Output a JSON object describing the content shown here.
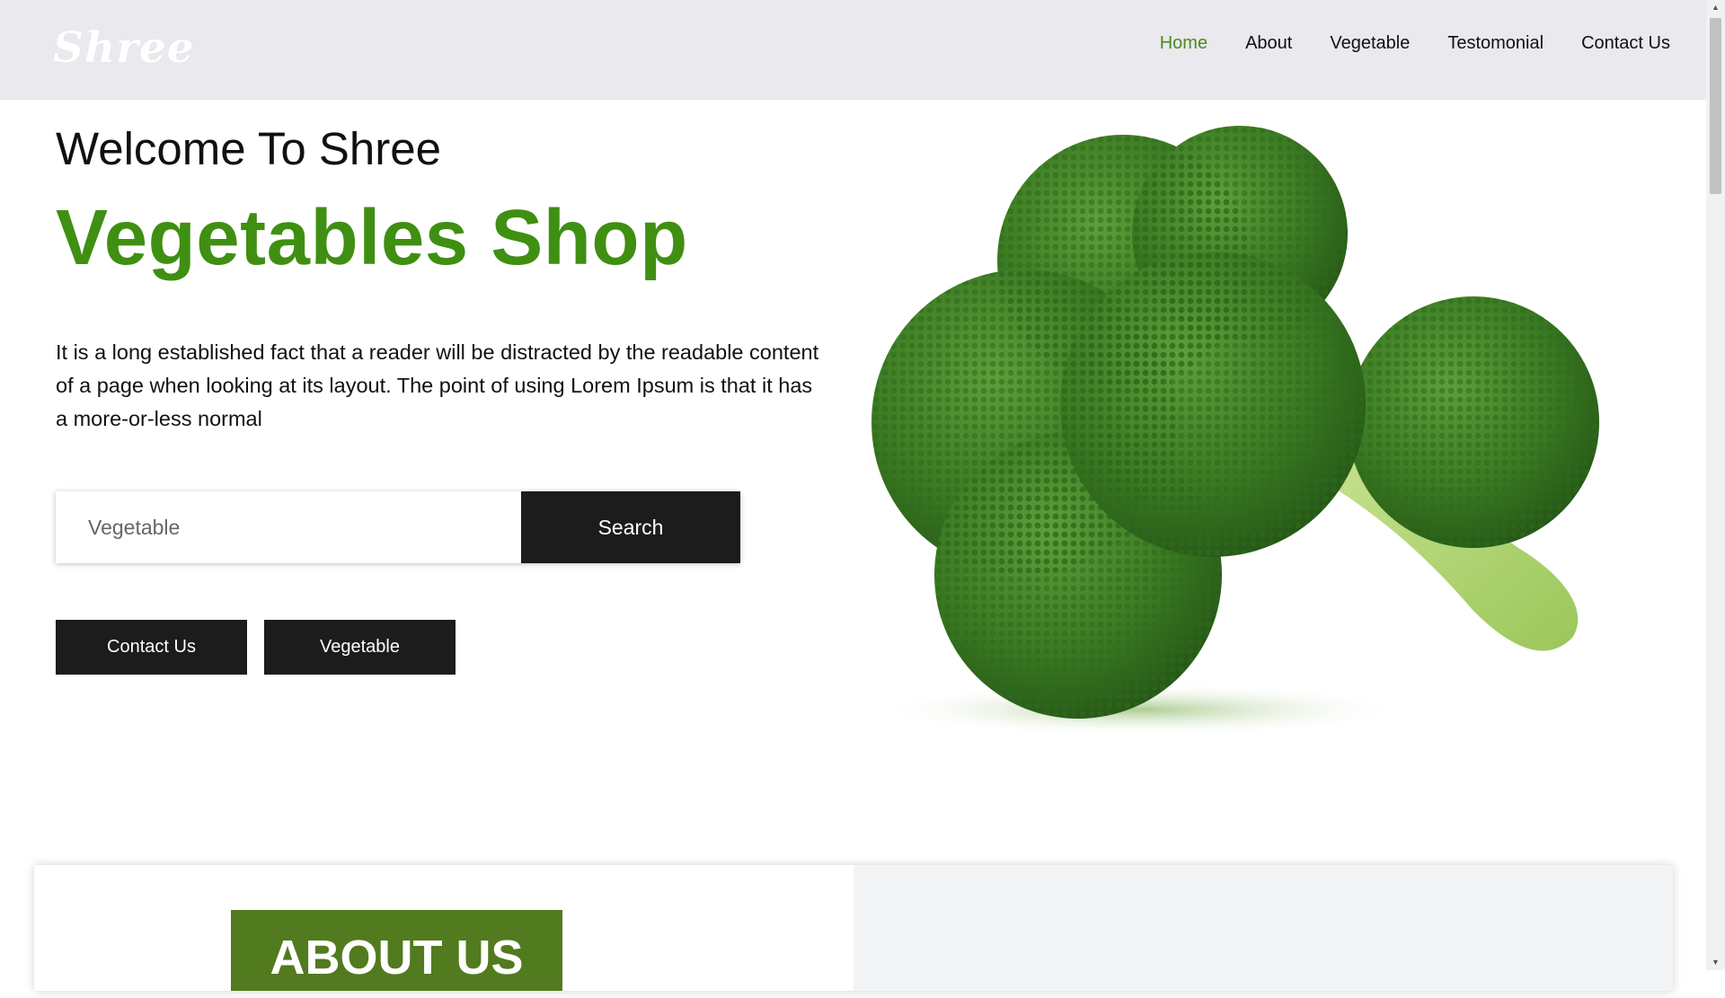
{
  "header": {
    "logo": "Shree",
    "nav": [
      {
        "label": "Home",
        "active": true
      },
      {
        "label": "About",
        "active": false
      },
      {
        "label": "Vegetable",
        "active": false
      },
      {
        "label": "Testomonial",
        "active": false
      },
      {
        "label": "Contact Us",
        "active": false
      }
    ]
  },
  "hero": {
    "welcome": "Welcome To Shree",
    "title": "Vegetables Shop",
    "intro": "It is a long established fact that a reader will be distracted by the readable content of a page when looking at its layout. The point of using Lorem Ipsum is that it has a more-or-less normal",
    "search": {
      "placeholder": "Vegetable",
      "value": "",
      "button_label": "Search"
    },
    "buttons": {
      "contact": "Contact Us",
      "vegetable": "Vegetable"
    },
    "image": "broccoli"
  },
  "about": {
    "title": "ABOUT US"
  },
  "colors": {
    "accent_green": "#3f8f12",
    "nav_active": "#4c8a1a",
    "about_green": "#527a1e",
    "dark_button": "#1c1c1c",
    "header_bg": "#e9e9ee"
  }
}
